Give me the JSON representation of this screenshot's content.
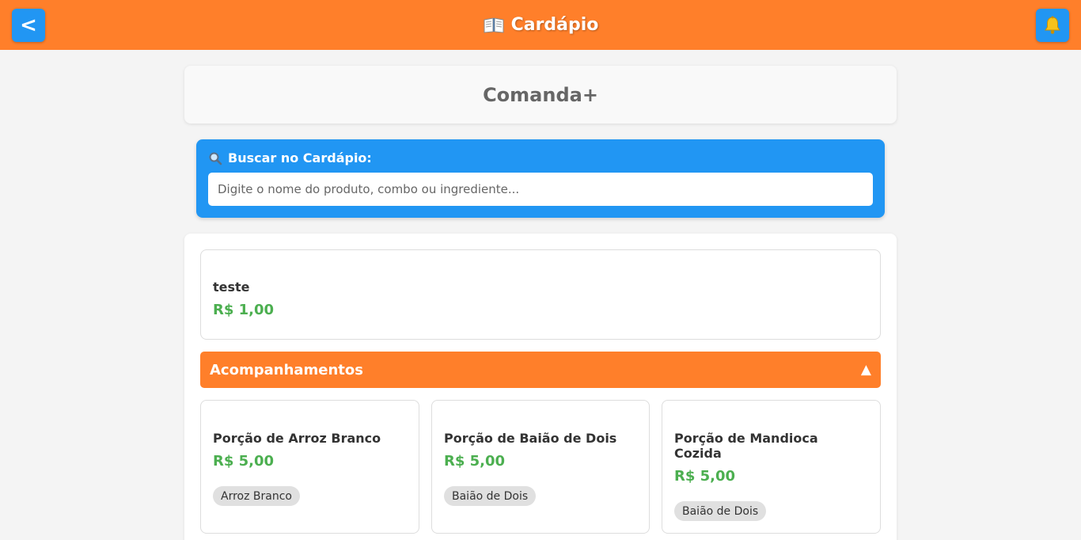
{
  "header": {
    "back_label": "<",
    "title": "Cardápio",
    "title_icon": "book-icon",
    "notifications_icon": "bell-icon",
    "accent_color": "#ff7f2a",
    "button_color": "#2196f3"
  },
  "brand": {
    "name": "Comanda+"
  },
  "search": {
    "label": "Buscar no Cardápio:",
    "icon": "search-icon",
    "placeholder": "Digite o nome do produto, combo ou ingrediente...",
    "value": ""
  },
  "menu": {
    "featured": {
      "name": "teste",
      "price": "R$ 1,00"
    },
    "category": {
      "name": "Acompanhamentos",
      "toggle": "▲"
    },
    "items": [
      {
        "name": "Porção de Arroz Branco",
        "price": "R$ 5,00",
        "tag": "Arroz Branco"
      },
      {
        "name": "Porção de Baião de Dois",
        "price": "R$ 5,00",
        "tag": "Baião de Dois"
      },
      {
        "name_line1": "Porção de Mandioca",
        "name_line2": "Cozida",
        "price": "R$ 5,00",
        "tag": "Baião de Dois"
      }
    ],
    "price_color": "#4caf50"
  }
}
